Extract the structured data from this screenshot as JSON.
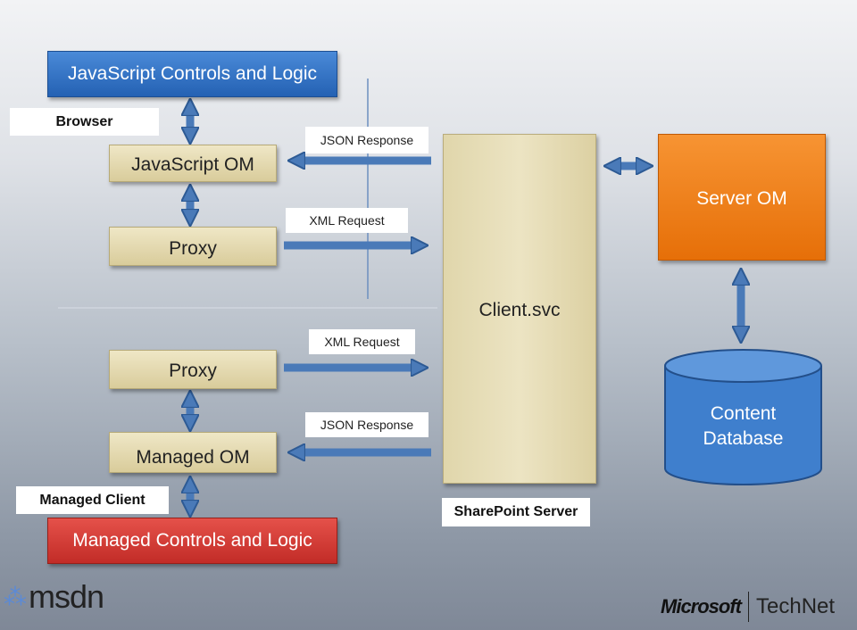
{
  "browser_side": {
    "top_box": "JavaScript Controls and Logic",
    "label": "Browser",
    "om": "JavaScript OM",
    "proxy": "Proxy",
    "response": "JSON Response",
    "request": "XML Request"
  },
  "managed_side": {
    "proxy": "Proxy",
    "om": "Managed OM",
    "label": "Managed Client",
    "bottom_box": "Managed Controls and Logic",
    "request": "XML Request",
    "response": "JSON Response"
  },
  "server": {
    "service": "Client.svc",
    "server_om": "Server OM",
    "database": "Content Database",
    "label": "SharePoint Server"
  },
  "logos": {
    "left": "msdn",
    "right_brand": "Microsoft",
    "right_product": "TechNet"
  },
  "colors": {
    "blue": "#2f6fc0",
    "tan": "#e3d8aa",
    "orange": "#f07f12",
    "red": "#d33a34",
    "arrow": "#4a7ab8"
  }
}
